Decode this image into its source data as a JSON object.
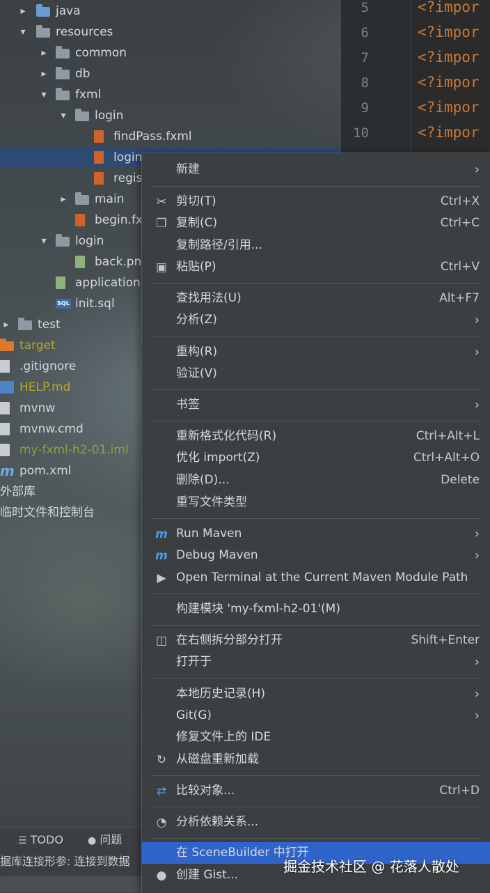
{
  "tree": [
    {
      "label": "java",
      "icon": "folder-icon",
      "kind": "folder-blue",
      "chevron": "›"
    },
    {
      "label": "resources",
      "icon": "folder-icon",
      "kind": "folder",
      "chevron": "⌄"
    },
    {
      "label": "common",
      "icon": "folder-icon",
      "kind": "folder",
      "chevron": "›"
    },
    {
      "label": "db",
      "icon": "folder-icon",
      "kind": "folder",
      "chevron": "›"
    },
    {
      "label": "fxml",
      "icon": "folder-icon",
      "kind": "folder",
      "chevron": "⌄"
    },
    {
      "label": "login",
      "icon": "folder-icon",
      "kind": "folder",
      "chevron": "⌄"
    },
    {
      "label": "findPass.fxml",
      "icon": "fxml-file-icon",
      "kind": "fx"
    },
    {
      "label": "login",
      "icon": "fxml-file-icon",
      "kind": "fx",
      "selected": true
    },
    {
      "label": "regis",
      "icon": "fxml-file-icon",
      "kind": "fx"
    },
    {
      "label": "main",
      "icon": "folder-icon",
      "kind": "folder",
      "chevron": "›"
    },
    {
      "label": "begin.fx",
      "icon": "fxml-file-icon",
      "kind": "fx"
    },
    {
      "label": "login",
      "icon": "folder-icon",
      "kind": "folder",
      "chevron": "⌄"
    },
    {
      "label": "back.pn",
      "icon": "image-file-icon",
      "kind": "png"
    },
    {
      "label": "application",
      "icon": "spring-config-icon",
      "kind": "png"
    },
    {
      "label": "init.sql",
      "icon": "sql-file-icon",
      "kind": "sql"
    },
    {
      "label": "test",
      "icon": "folder-icon",
      "kind": "folder",
      "chevron": "›"
    },
    {
      "label": "target",
      "icon": "folder-icon",
      "kind": "folder-orange",
      "color": "yellow"
    },
    {
      "label": ".gitignore",
      "icon": "file-icon",
      "kind": "file"
    },
    {
      "label": "HELP.md",
      "icon": "markdown-file-icon",
      "kind": "md",
      "color": "yellow"
    },
    {
      "label": "mvnw",
      "icon": "script-file-icon",
      "kind": "file"
    },
    {
      "label": "mvnw.cmd",
      "icon": "file-icon",
      "kind": "file"
    },
    {
      "label": "my-fxml-h2-01.iml",
      "icon": "iml-file-icon",
      "kind": "file",
      "color": "green"
    },
    {
      "label": "pom.xml",
      "icon": "maven-icon",
      "kind": "mvn"
    },
    {
      "label": "外部库",
      "icon": "",
      "kind": "none"
    },
    {
      "label": "临时文件和控制台",
      "icon": "",
      "kind": "none"
    }
  ],
  "editor": {
    "line_numbers": [
      "5",
      "6",
      "7",
      "8",
      "9",
      "10"
    ],
    "code_text": "<?impor"
  },
  "bottom": {
    "todo": "TODO",
    "problems": "问题",
    "status": "据库连接形参: 连接到数据"
  },
  "menu": [
    {
      "label": "新建",
      "sub": "›"
    },
    {
      "sep": true
    },
    {
      "label": "剪切(T)",
      "icon": "scissors-icon",
      "sc": "Ctrl+X"
    },
    {
      "label": "复制(C)",
      "icon": "copy-icon",
      "sc": "Ctrl+C"
    },
    {
      "label": "复制路径/引用..."
    },
    {
      "label": "粘贴(P)",
      "icon": "paste-icon",
      "sc": "Ctrl+V"
    },
    {
      "sep": true
    },
    {
      "label": "查找用法(U)",
      "sc": "Alt+F7"
    },
    {
      "label": "分析(Z)",
      "sub": "›"
    },
    {
      "sep": true
    },
    {
      "label": "重构(R)",
      "sub": "›"
    },
    {
      "label": "验证(V)"
    },
    {
      "sep": true
    },
    {
      "label": "书签",
      "sub": "›"
    },
    {
      "sep": true
    },
    {
      "label": "重新格式化代码(R)",
      "sc": "Ctrl+Alt+L"
    },
    {
      "label": "优化 import(Z)",
      "sc": "Ctrl+Alt+O"
    },
    {
      "label": "删除(D)...",
      "sc": "Delete"
    },
    {
      "label": "重写文件类型"
    },
    {
      "sep": true
    },
    {
      "label": "Run Maven",
      "icon": "maven-run-icon",
      "sub": "›"
    },
    {
      "label": "Debug Maven",
      "icon": "maven-debug-icon",
      "sub": "›"
    },
    {
      "label": "Open Terminal at the Current Maven Module Path",
      "icon": "terminal-icon"
    },
    {
      "sep": true
    },
    {
      "label": "构建模块 'my-fxml-h2-01'(M)"
    },
    {
      "sep": true
    },
    {
      "label": "在右侧拆分部分打开",
      "icon": "split-icon",
      "sc": "Shift+Enter"
    },
    {
      "label": "打开于",
      "sub": "›"
    },
    {
      "sep": true
    },
    {
      "label": "本地历史记录(H)",
      "sub": "›"
    },
    {
      "label": "Git(G)",
      "sub": "›"
    },
    {
      "label": "修复文件上的 IDE"
    },
    {
      "label": "从磁盘重新加载",
      "icon": "reload-icon"
    },
    {
      "sep": true
    },
    {
      "label": "比较对象...",
      "icon": "compare-icon",
      "sc": "Ctrl+D"
    },
    {
      "sep": true
    },
    {
      "label": "分析依赖关系...",
      "icon": "analyze-icon"
    },
    {
      "sep": true
    },
    {
      "label": "在 SceneBuilder 中打开",
      "highlight": true
    },
    {
      "label": "创建 Gist...",
      "icon": "github-icon"
    }
  ],
  "watermark": "掘金技术社区 @ 花落人散处"
}
